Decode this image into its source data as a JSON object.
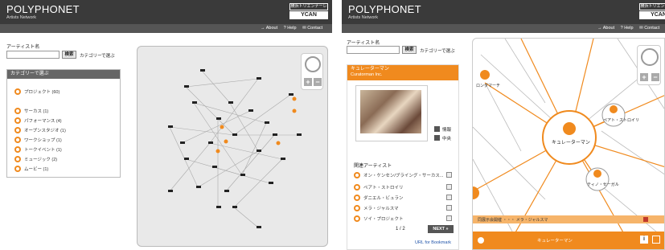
{
  "left": {
    "header": {
      "logo": "POLYPHONET",
      "subtitle": "Artists Network",
      "box_top": "横浜トリエンナーレ",
      "box_bottom": "YCAN"
    },
    "nav": {
      "about": "→ About",
      "help": "? Help",
      "contact": "✉ Contact"
    },
    "search": {
      "label": "アーティスト名",
      "button": "検索",
      "category_link": "カテゴリーで選ぶ",
      "value": ""
    },
    "categories": {
      "title": "カテゴリーで選ぶ",
      "items": [
        {
          "label": "プロジェクト (60)"
        },
        {
          "label": "サーカス (1)"
        },
        {
          "label": "パフォーマンス (4)"
        },
        {
          "label": "オープンスタジオ (1)"
        },
        {
          "label": "ワークショップ (1)"
        },
        {
          "label": "トークイベント (1)"
        },
        {
          "label": "ミュージック (2)"
        },
        {
          "label": "ムービー (1)"
        }
      ]
    },
    "zoom": {
      "plus": "+",
      "minus": "−"
    }
  },
  "right": {
    "header": {
      "logo": "POLYPHONET",
      "subtitle": "Artists Network",
      "box_top": "横浜トリエンナーレ",
      "box_bottom": "YCAN"
    },
    "nav": {
      "about": "→ About",
      "help": "? Help",
      "contact": "✉ Contact"
    },
    "search": {
      "label": "アーティスト名",
      "button": "検索",
      "category_link": "カテゴリーで選ぶ"
    },
    "artist": {
      "name": "キュレーターマン",
      "org": "Curatorman Inc.",
      "info_link": "情報",
      "center_link": "中央",
      "related_title": "関連アーティスト",
      "related": [
        {
          "label": "オン・ケンセン/ブライング・サーカス..."
        },
        {
          "label": "ペアト・ストロイリ"
        },
        {
          "label": "ダニエル・ビュラン"
        },
        {
          "label": "メラ・ジャルスマ"
        },
        {
          "label": "ソイ・プロジェクト"
        }
      ],
      "pagination": "1 / 2",
      "next": "NEXT »",
      "bookmark": "URL for Bookmark"
    },
    "graph": {
      "center": "キュレーターマン",
      "nodes": [
        "ロンダマーチ",
        "ペアト・ストロイリ",
        "ティノ・セーガル"
      ],
      "bar_text": "同展示会開催 ・・・ メラ・ジャルスマ",
      "bottom_text": "キュレーターマン"
    },
    "zoom": {
      "plus": "+",
      "minus": "−"
    }
  },
  "colors": {
    "accent": "#f08a1e",
    "header": "#3a3a3a",
    "edge": "#aaaaaa"
  }
}
